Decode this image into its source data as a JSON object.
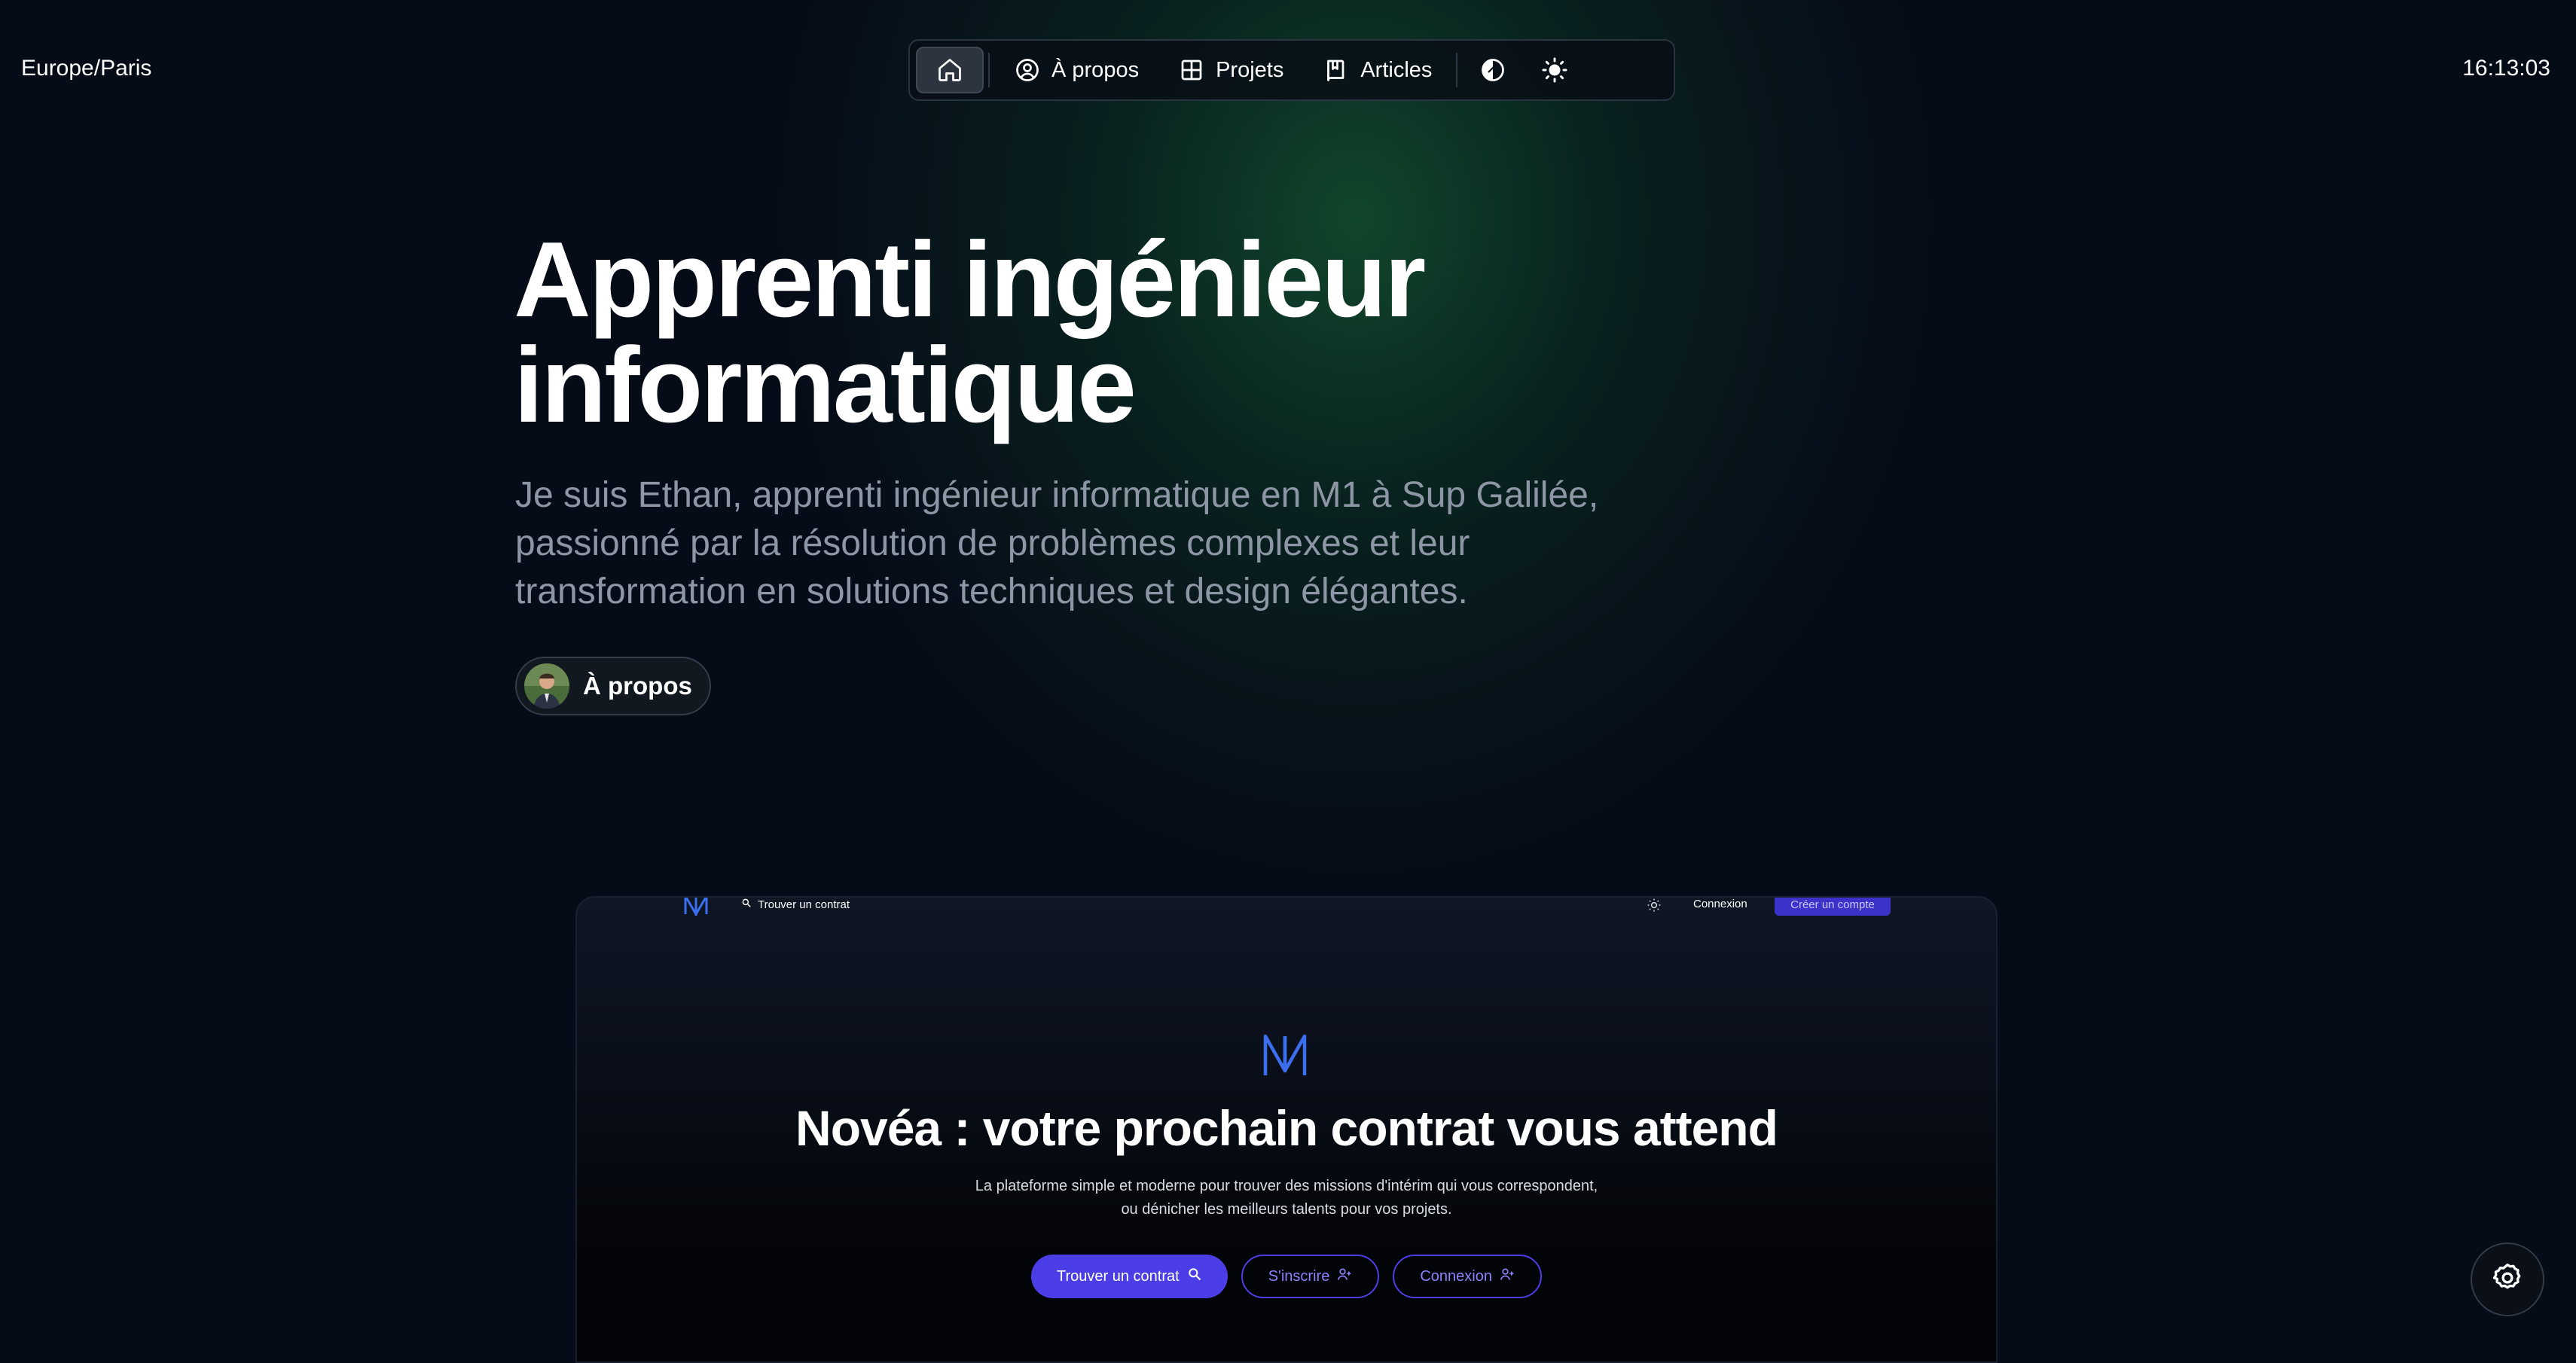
{
  "header": {
    "timezone": "Europe/Paris",
    "time": "16:13:03"
  },
  "nav": {
    "items": [
      {
        "icon": "home-icon",
        "label": ""
      },
      {
        "icon": "user-circle-icon",
        "label": "À propos"
      },
      {
        "icon": "grid-icon",
        "label": "Projets"
      },
      {
        "icon": "book-icon",
        "label": "Articles"
      }
    ],
    "theme_icon": "contrast-icon",
    "light_icon": "sun-icon"
  },
  "hero": {
    "title_line1": "Apprenti ingénieur",
    "title_line2": "informatique",
    "subtitle": "Je suis Ethan, apprenti ingénieur informatique en M1 à Sup Galilée, passionné par la résolution de problèmes complexes et leur transformation en solutions techniques et design élégantes.",
    "about_button": "À propos"
  },
  "project_preview": {
    "nav_search": "Trouver un contrat",
    "nav_login": "Connexion",
    "nav_create": "Créer un compte",
    "title": "Novéa : votre prochain contrat vous attend",
    "desc_line1": "La plateforme simple et moderne pour trouver des missions d'intérim qui vous correspondent,",
    "desc_line2": "ou dénicher les meilleurs talents pour vos projets.",
    "btn_find": "Trouver un contrat",
    "btn_signup": "S'inscrire",
    "btn_login": "Connexion"
  },
  "colors": {
    "background": "#060b18",
    "accent_glow": "#145a32",
    "brand_indigo": "#4b3ee6",
    "muted_text": "#8d96a5"
  }
}
